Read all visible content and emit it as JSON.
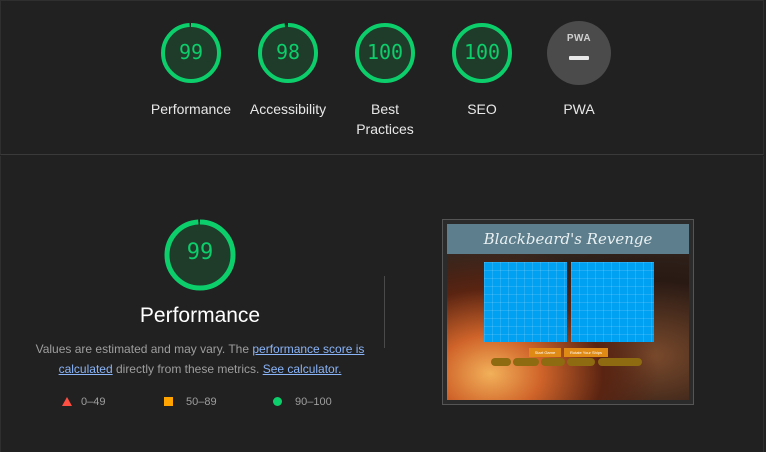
{
  "categories": [
    {
      "label": "Performance",
      "score": "99",
      "value": 99
    },
    {
      "label": "Accessibility",
      "score": "98",
      "value": 98
    },
    {
      "label": "Best Practices",
      "score": "100",
      "value": 100
    },
    {
      "label": "SEO",
      "score": "100",
      "value": 100
    },
    {
      "label": "PWA",
      "badge": "PWA"
    }
  ],
  "performance": {
    "score": "99",
    "value": 99,
    "title": "Performance",
    "desc_prefix": "Values are estimated and may vary. The ",
    "link1": "performance score is calculated",
    "desc_middle": " directly from these metrics. ",
    "link2": "See calculator."
  },
  "legend": [
    {
      "range": "0–49",
      "color": "#ff4e42",
      "shape": "triangle"
    },
    {
      "range": "50–89",
      "color": "#ffa400",
      "shape": "square"
    },
    {
      "range": "90–100",
      "color": "#0cce6b",
      "shape": "circle"
    }
  ],
  "screenshot": {
    "title": "Blackbeard's Revenge",
    "button1": "Start Game",
    "button2": "Rotate Your Ships"
  },
  "colors": {
    "pass": "#0cce6b",
    "background": "#212121"
  }
}
